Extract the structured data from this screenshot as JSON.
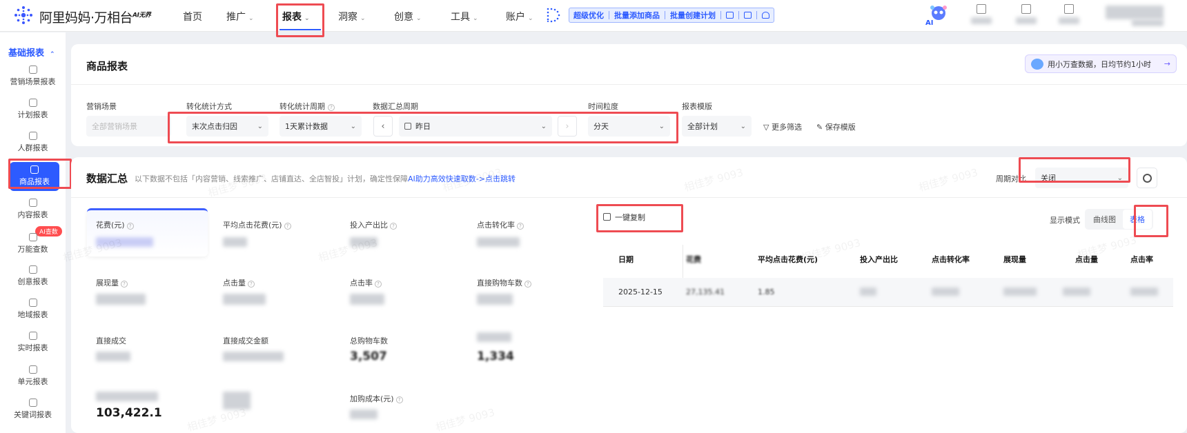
{
  "brand": {
    "name": "阿里妈妈·万相台",
    "tag": "AI无界"
  },
  "nav": {
    "items": [
      {
        "label": "首页",
        "has_menu": false
      },
      {
        "label": "推广",
        "has_menu": true
      },
      {
        "label": "报表",
        "has_menu": true,
        "active": true
      },
      {
        "label": "洞察",
        "has_menu": true
      },
      {
        "label": "创意",
        "has_menu": true
      },
      {
        "label": "工具",
        "has_menu": true
      },
      {
        "label": "账户",
        "has_menu": true
      }
    ],
    "promo_links": [
      "超级优化",
      "批量添加商品",
      "批量创建计划"
    ],
    "ai_label": "AI"
  },
  "sidebar": {
    "section_title": "基础报表",
    "items": [
      {
        "label": "营销场景报表"
      },
      {
        "label": "计划报表"
      },
      {
        "label": "人群报表"
      },
      {
        "label": "商品报表",
        "active": true
      },
      {
        "label": "内容报表"
      },
      {
        "label": "万能查数",
        "badge": "AI查数"
      },
      {
        "label": "创意报表"
      },
      {
        "label": "地域报表"
      },
      {
        "label": "实时报表"
      },
      {
        "label": "单元报表"
      },
      {
        "label": "关键词报表"
      }
    ]
  },
  "report": {
    "title": "商品报表",
    "helper_text": "用小万查数据，日均节约1小时",
    "filters": {
      "scene": {
        "label": "营销场景",
        "value": "全部营销场景"
      },
      "attribution": {
        "label": "转化统计方式",
        "value": "末次点击归因"
      },
      "cycle": {
        "label": "转化统计周期",
        "value": "1天累计数据"
      },
      "summary_period": {
        "label": "数据汇总周期",
        "value": "昨日"
      },
      "granularity": {
        "label": "时间粒度",
        "value": "分天"
      },
      "template": {
        "label": "报表模版",
        "value": "全部计划"
      },
      "more_filters": "更多筛选",
      "save_template": "保存模版"
    }
  },
  "summary": {
    "title": "数据汇总",
    "description_prefix": "以下数据不包括「内容营销、线索推广、店铺直达、全店智投」计划，确定性保障",
    "description_link": "AI助力高效快速取数->点击跳转",
    "compare_label": "周期对比",
    "compare_value": "关闭",
    "metrics": [
      {
        "label": "花费(元)",
        "value": "",
        "active": true
      },
      {
        "label": "平均点击花费(元)",
        "value": ""
      },
      {
        "label": "投入产出比",
        "value": ""
      },
      {
        "label": "点击转化率",
        "value": ""
      },
      {
        "label": "展现量",
        "value": ""
      },
      {
        "label": "点击量",
        "value": ""
      },
      {
        "label": "点击率",
        "value": ""
      },
      {
        "label": "直接购物车数",
        "value": ""
      },
      {
        "label": "直接成交",
        "value": ""
      },
      {
        "label": "直接成交金额",
        "value": ""
      },
      {
        "label": "总购物车数",
        "value": "3,507"
      },
      {
        "label": "",
        "value": "1,334"
      },
      {
        "label": "",
        "value": "103,422.1"
      },
      {
        "label": "",
        "value": ""
      },
      {
        "label": "加购成本(元)",
        "value": ""
      }
    ],
    "copy_button": "一键复制",
    "display_mode_label": "显示模式",
    "display_modes": [
      {
        "label": "曲线图"
      },
      {
        "label": "表格",
        "active": true
      }
    ],
    "table": {
      "columns": [
        "日期",
        "花费",
        "平均点击花费(元)",
        "投入产出比",
        "点击转化率",
        "展现量",
        "点击量",
        "点击率"
      ],
      "rows": [
        [
          "2025-12-15",
          "27,135.41",
          "1.85",
          "",
          "",
          "",
          "",
          ""
        ]
      ]
    }
  },
  "watermark": "相佳梦 9093",
  "colors": {
    "accent": "#2d5bff",
    "highlight_box": "#ee4b52",
    "badge": "#ff4d4f"
  }
}
